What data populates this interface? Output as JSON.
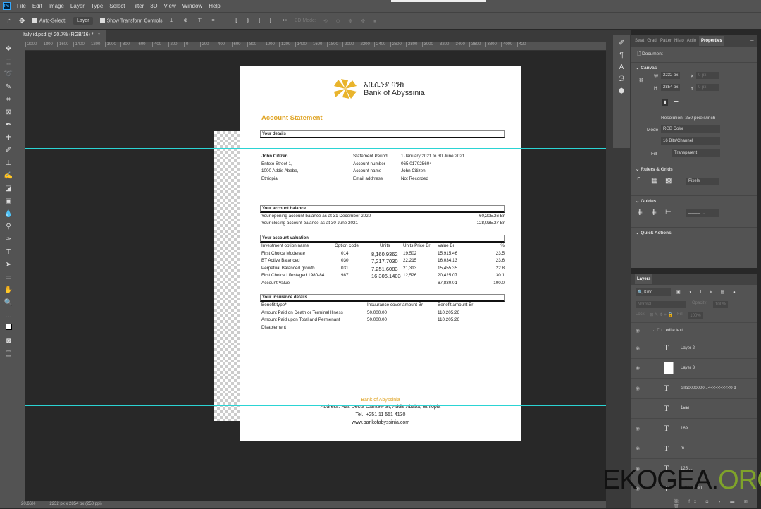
{
  "menu": [
    "File",
    "Edit",
    "Image",
    "Layer",
    "Type",
    "Select",
    "Filter",
    "3D",
    "View",
    "Window",
    "Help"
  ],
  "options": {
    "auto_select": "Auto-Select:",
    "layer_select": "Layer",
    "show_transform": "Show Transform Controls",
    "more": "•••",
    "mode_3d": "3D Mode:"
  },
  "tab": {
    "title": "Italy id.psd @ 20.7% (RGB/16) *",
    "close": "×"
  },
  "ruler": [
    "2000",
    "1800",
    "1600",
    "1400",
    "1200",
    "1000",
    "800",
    "600",
    "400",
    "200",
    "0",
    "200",
    "400",
    "600",
    "800",
    "1000",
    "1200",
    "1400",
    "1600",
    "1800",
    "2000",
    "2200",
    "2400",
    "2600",
    "2800",
    "3000",
    "3200",
    "3400",
    "3600",
    "3800",
    "4000",
    "420"
  ],
  "status": {
    "zoom": "20.66%",
    "size": "2232 px x 2854 px (250 ppi)"
  },
  "document": {
    "bank_amharic": "አቢሲንያ ባንክ",
    "bank_name": "Bank of Abyssinia",
    "title": "Account Statement",
    "details_header": "Your details",
    "customer": [
      "John Citizen",
      "Entoto Street 1,",
      "1000 Addis Ababa,",
      "Ethiopia"
    ],
    "info": [
      {
        "label": "Statement Period",
        "value": "1 January 2021 to 30 June 2021"
      },
      {
        "label": "Account number",
        "value": "065 017025604"
      },
      {
        "label": "Account name",
        "value": "John Citizen"
      },
      {
        "label": "Email addrress",
        "value": "Not Recorded"
      }
    ],
    "balance_header": "Your account balance",
    "balances": [
      {
        "label": "Your opening account balance as at 31 December 2020",
        "value": "60,205.26 Br"
      },
      {
        "label": "Your closing account balance as at 30 June 2021",
        "value": "128,035.27 Br"
      }
    ],
    "valuation_header": "Your account valuation",
    "valuation_cols": [
      "Investment option name",
      "Option code",
      "Units",
      "Units Price Br",
      "Value Br",
      "%"
    ],
    "valuation_rows": [
      [
        "First Choice Moderate",
        "014",
        "8,160.9362",
        "19,502",
        "15,915.46",
        "23.5"
      ],
      [
        "BT Active Balanced",
        "030",
        "7,217.7030",
        "22,215",
        "16,034.13",
        "23.6"
      ],
      [
        "Perpetual Balanced growth",
        "031",
        "7,251.6083",
        "21,313",
        "15,455.35",
        "22.8"
      ],
      [
        "First Choice Lifestaged 1980-84",
        "987",
        "16,306.1403",
        "12,526",
        "20,425.07",
        "30.1"
      ],
      [
        "Account Value",
        "",
        "",
        "",
        "67,830.01",
        "100.0"
      ]
    ],
    "insurance_header": "Your insurance details",
    "insurance_cols": [
      "Benefit type*",
      "Insuurance cover amount Br",
      "Benefit amount Br"
    ],
    "insurance_rows": [
      [
        "Amount Paid on Death or Terminal Illness",
        "50,000.00",
        "110,205.26"
      ],
      [
        "Amount Paid upon Total and Permenant",
        "50,000.00",
        "110,205.26"
      ],
      [
        "Disablement",
        "",
        ""
      ]
    ],
    "footer": {
      "name": "Bank of Abyssinia",
      "address": "Address: Ras Desta Damtew St, Addis Ababa, Ethiopia",
      "tel": "Tel.: +251 11 551 4130",
      "web": "www.bankofabyssinia.com"
    }
  },
  "properties": {
    "tabs": [
      "Swat",
      "Gradi",
      "Patter",
      "Histo",
      "Actio",
      "Properties"
    ],
    "document_label": "Document",
    "canvas": "Canvas",
    "w_label": "W",
    "w": "2232 px",
    "h_label": "H",
    "h": "2854 px",
    "x_label": "X",
    "x": "0 px",
    "y_label": "Y",
    "y": "0 px",
    "resolution": "Resolution: 250 pixels/inch",
    "mode_label": "Mode",
    "mode": "RGB Color",
    "depth": "16 Bits/Channel",
    "fill_label": "Fill",
    "fill": "Transparent",
    "rulers": "Rulers & Grids",
    "units": "Pixels",
    "guides": "Guides",
    "quick_actions": "Quick Actions"
  },
  "layers": {
    "title": "Layers",
    "kind": "Kind",
    "blend": "Normal",
    "opacity_label": "Opacity:",
    "opacity": "100%",
    "lock_label": "Lock:",
    "fill_label": "Fill:",
    "fill": "100%",
    "items": [
      {
        "name": "edite text",
        "type": "group"
      },
      {
        "name": "Layer 2",
        "type": "text"
      },
      {
        "name": "Layer 3",
        "type": "image"
      },
      {
        "name": "cillа0000000...<<<<<<<<<0 d",
        "type": "text"
      },
      {
        "name": "1ыы",
        "type": "text"
      },
      {
        "name": "169",
        "type": "text"
      },
      {
        "name": "m",
        "type": "text"
      },
      {
        "name": "125 ...",
        "type": "text"
      },
      {
        "name": "01.01.1990",
        "type": "text"
      }
    ]
  },
  "watermark": {
    "a": "EKOGEA.",
    "b": "ORG"
  },
  "colors": {
    "accent": "#e0a527",
    "guide": "#2bd4d4",
    "panel": "#535353",
    "workspace": "#282828"
  }
}
